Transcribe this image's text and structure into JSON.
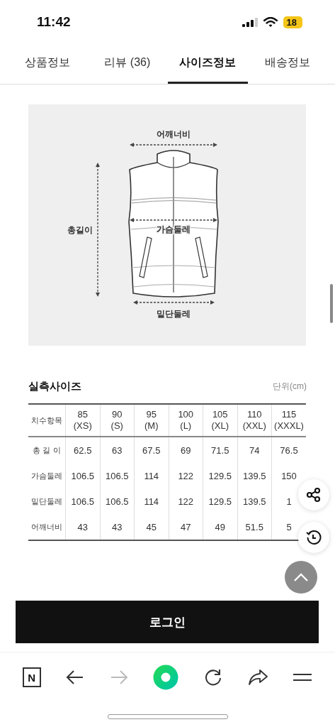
{
  "status_bar": {
    "time": "11:42",
    "battery": "18"
  },
  "tabs": [
    {
      "label": "상품정보",
      "selected": false
    },
    {
      "label": "리뷰 (36)",
      "selected": false
    },
    {
      "label": "사이즈정보",
      "selected": true
    },
    {
      "label": "배송정보",
      "selected": false
    }
  ],
  "size_diagram": {
    "labels": [
      {
        "kind": "shoulder",
        "text": "어깨너비"
      },
      {
        "kind": "length",
        "text": "총길이"
      },
      {
        "kind": "chest",
        "text": "가슴둘레"
      },
      {
        "kind": "hem",
        "text": "밑단둘레"
      }
    ]
  },
  "size_table": {
    "title": "실측사이즈",
    "unit": "단위(cm)",
    "corner": "치수항목",
    "columns": [
      "85\n(XS)",
      "90\n(S)",
      "95\n(M)",
      "100\n(L)",
      "105\n(XL)",
      "110\n(XXL)",
      "115\n(XXXL)"
    ],
    "rows": [
      {
        "label": "총 길 이",
        "values": [
          "62.5",
          "63",
          "67.5",
          "69",
          "71.5",
          "74",
          "76.5"
        ]
      },
      {
        "label": "가슴둘레",
        "values": [
          "106.5",
          "106.5",
          "114",
          "122",
          "129.5",
          "139.5",
          "150"
        ]
      },
      {
        "label": "밑단둘레",
        "values": [
          "106.5",
          "106.5",
          "114",
          "122",
          "129.5",
          "139.5",
          "1"
        ]
      },
      {
        "label": "어깨너비",
        "values": [
          "43",
          "43",
          "45",
          "47",
          "49",
          "51.5",
          "5"
        ]
      }
    ]
  },
  "login_button": "로그인",
  "toolbar": {
    "logo": "N",
    "items": [
      {
        "kind": "back",
        "disabled": false
      },
      {
        "kind": "forward",
        "disabled": true
      },
      {
        "kind": "home",
        "disabled": false
      },
      {
        "kind": "reload",
        "disabled": false
      },
      {
        "kind": "share",
        "disabled": false
      },
      {
        "kind": "menu",
        "disabled": false
      }
    ]
  }
}
